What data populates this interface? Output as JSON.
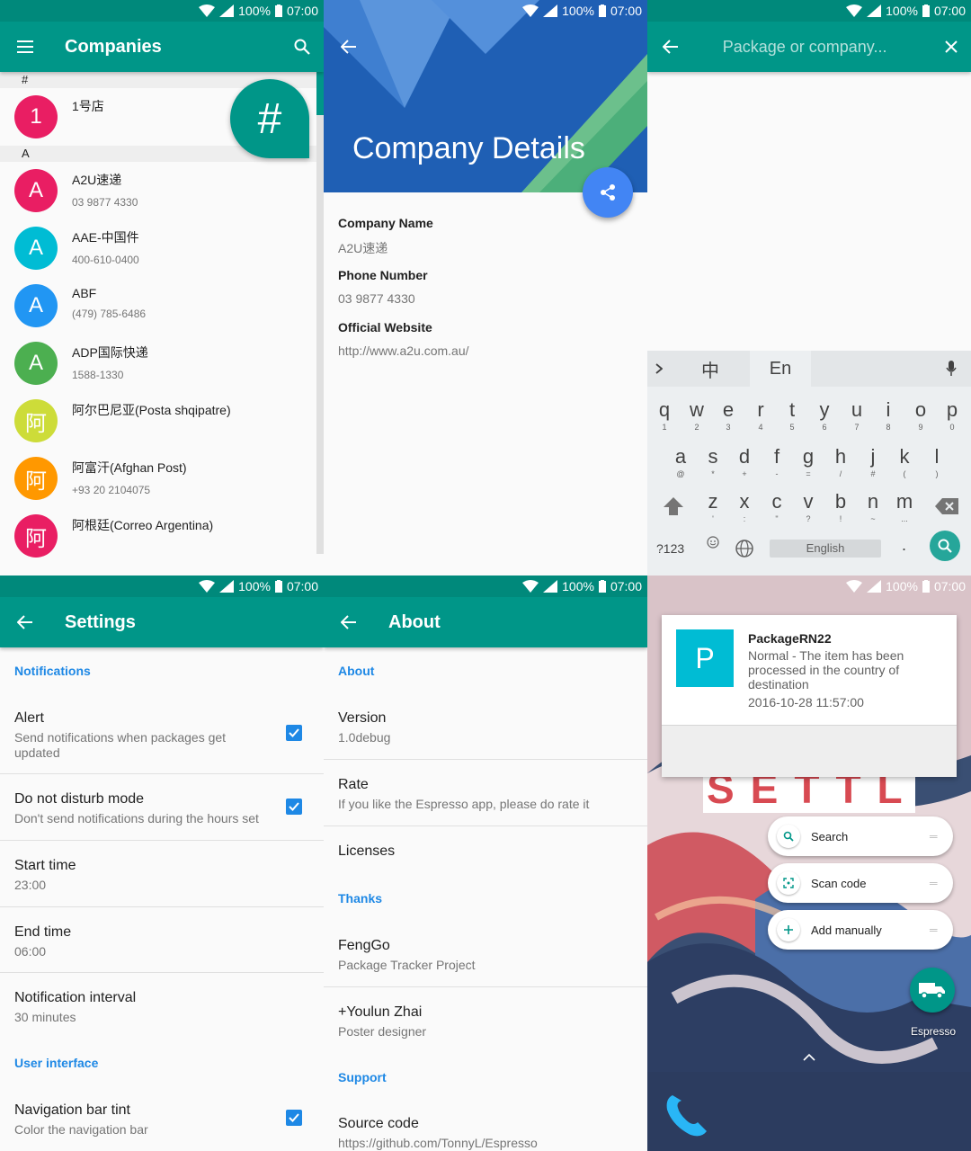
{
  "status": {
    "battery": "100%",
    "time": "07:00"
  },
  "companies": {
    "title": "Companies",
    "fast_scroll_letter": "#",
    "sections": [
      {
        "header": "#",
        "items": [
          {
            "letter": "1",
            "name": "1号店",
            "phone": "",
            "color": "#e91e63"
          }
        ]
      },
      {
        "header": "A",
        "items": [
          {
            "letter": "A",
            "name": "A2U速递",
            "phone": "03 9877 4330",
            "color": "#e91e63"
          },
          {
            "letter": "A",
            "name": "AAE-中国件",
            "phone": "400-610-0400",
            "color": "#00bcd4"
          },
          {
            "letter": "A",
            "name": "ABF",
            "phone": "(479) 785-6486",
            "color": "#2196f3"
          },
          {
            "letter": "A",
            "name": "ADP国际快递",
            "phone": "1588-1330",
            "color": "#4caf50"
          },
          {
            "letter": "阿",
            "name": "阿尔巴尼亚(Posta shqipatre)",
            "phone": "",
            "color": "#cddc39"
          },
          {
            "letter": "阿",
            "name": "阿富汗(Afghan Post)",
            "phone": "+93 20 2104075",
            "color": "#ff9800"
          },
          {
            "letter": "阿",
            "name": "阿根廷(Correo Argentina)",
            "phone": "",
            "color": "#e91e63"
          }
        ]
      }
    ]
  },
  "details": {
    "title": "Company Details",
    "fields": [
      {
        "label": "Company Name",
        "value": "A2U速递"
      },
      {
        "label": "Phone Number",
        "value": "03 9877 4330"
      },
      {
        "label": "Official Website",
        "value": "http://www.a2u.com.au/"
      }
    ]
  },
  "search": {
    "placeholder": "Package or company...",
    "keyboard": {
      "tab_chinese": "中",
      "tab_english": "En",
      "row1": [
        [
          "q",
          "1"
        ],
        [
          "w",
          "2"
        ],
        [
          "e",
          "3"
        ],
        [
          "r",
          "4"
        ],
        [
          "t",
          "5"
        ],
        [
          "y",
          "6"
        ],
        [
          "u",
          "7"
        ],
        [
          "i",
          "8"
        ],
        [
          "o",
          "9"
        ],
        [
          "p",
          "0"
        ]
      ],
      "row2": [
        [
          "a",
          "@"
        ],
        [
          "s",
          "*"
        ],
        [
          "d",
          "+"
        ],
        [
          "f",
          "-"
        ],
        [
          "g",
          "="
        ],
        [
          "h",
          "/"
        ],
        [
          "j",
          "#"
        ],
        [
          "k",
          "("
        ],
        [
          "l",
          ")"
        ]
      ],
      "row3": [
        [
          "z",
          "'"
        ],
        [
          "x",
          ":"
        ],
        [
          "c",
          "\""
        ],
        [
          "v",
          "?"
        ],
        [
          "b",
          "!"
        ],
        [
          "n",
          "~"
        ],
        [
          "m",
          "..."
        ]
      ],
      "symbols_key": "?123",
      "space_label": "English",
      "period_key": "."
    }
  },
  "settings": {
    "title": "Settings",
    "categories": {
      "notifications": "Notifications",
      "ui": "User interface"
    },
    "alert": {
      "title": "Alert",
      "summary": "Send notifications when packages get updated"
    },
    "dnd": {
      "title": "Do not disturb mode",
      "summary": "Don't send notifications during the hours set"
    },
    "start": {
      "title": "Start time",
      "summary": "23:00"
    },
    "end": {
      "title": "End time",
      "summary": "06:00"
    },
    "interval": {
      "title": "Notification interval",
      "summary": "30 minutes"
    },
    "navbar": {
      "title": "Navigation bar tint",
      "summary": "Color the navigation bar"
    }
  },
  "about": {
    "title": "About",
    "categories": {
      "about": "About",
      "thanks": "Thanks",
      "support": "Support"
    },
    "version": {
      "title": "Version",
      "summary": "1.0debug"
    },
    "rate": {
      "title": "Rate",
      "summary": "If you like the Espresso app, please do rate it"
    },
    "licenses": {
      "title": "Licenses"
    },
    "fenggo": {
      "title": "FengGo",
      "summary": "Package Tracker Project"
    },
    "youlun": {
      "title": "+Youlun Zhai",
      "summary": "Poster designer"
    },
    "source": {
      "title": "Source code",
      "summary": "https://github.com/TonnyL/Espresso"
    }
  },
  "launcher": {
    "notification": {
      "icon_letter": "P",
      "title": "PackageRN22",
      "body": "Normal - The item has been processed in the country of destination",
      "time": "2016-10-28 11:57:00"
    },
    "wallpaper_text": "SETTLE",
    "shortcuts": [
      {
        "label": "Search",
        "icon": "search-icon"
      },
      {
        "label": "Scan code",
        "icon": "scan-icon"
      },
      {
        "label": "Add manually",
        "icon": "add-icon"
      }
    ],
    "app_label": "Espresso"
  },
  "colors": {
    "primary": "#009688",
    "primary_dark": "#00897b",
    "accent": "#1e88e5",
    "fab_blue": "#4285f4"
  }
}
